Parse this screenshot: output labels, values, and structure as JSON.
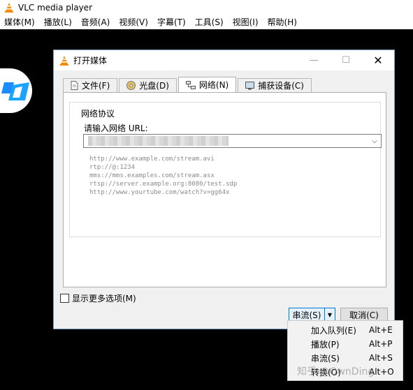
{
  "app": {
    "title": "VLC media player",
    "menus": [
      "媒体(M)",
      "播放(L)",
      "音频(A)",
      "视频(V)",
      "字幕(T)",
      "工具(S)",
      "视图(I)",
      "帮助(H)"
    ]
  },
  "dialog": {
    "title": "打开媒体",
    "tabs": [
      {
        "label": "文件(F)",
        "icon": "file-icon"
      },
      {
        "label": "光盘(D)",
        "icon": "disc-icon"
      },
      {
        "label": "网络(N)",
        "icon": "network-icon"
      },
      {
        "label": "捕获设备(C)",
        "icon": "capture-device-icon"
      }
    ],
    "active_tab": 2,
    "group_title": "网络协议",
    "url_label": "请输入网络 URL:",
    "url_value": "",
    "examples": [
      "http://www.example.com/stream.avi",
      "rtp://@:1234",
      "mms://mms.examples.com/stream.asx",
      "rtsp://server.example.org:8080/test.sdp",
      "http://www.yourtube.com/watch?v=gg64x"
    ],
    "more_options_label": "显示更多选项(M)",
    "stream_button": "串流(S)",
    "cancel_button": "取消(C)"
  },
  "dropdown": {
    "items": [
      {
        "label": "加入队列(E)",
        "shortcut": "Alt+E"
      },
      {
        "label": "播放(P)",
        "shortcut": "Alt+P"
      },
      {
        "label": "串流(S)",
        "shortcut": "Alt+S"
      },
      {
        "label": "转换(O)",
        "shortcut": "Alt+O"
      }
    ]
  },
  "watermark": "知乎 @OwnDing",
  "colors": {
    "vlc_orange": "#f08c00",
    "focus_blue": "#0078d7",
    "video_bg": "#000000"
  }
}
